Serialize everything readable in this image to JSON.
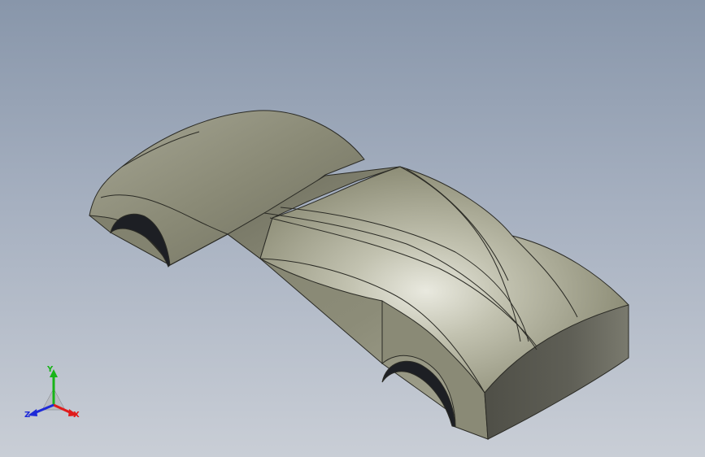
{
  "viewport": {
    "background_top": "#8896aa",
    "background_bottom": "#c9ced6"
  },
  "model": {
    "body_color": "#8f8f7a",
    "edge_color": "#2b2b25"
  },
  "triad": {
    "x_label": "X",
    "y_label": "Y",
    "z_label": "Z",
    "x_color": "#e01b1b",
    "y_color": "#18b418",
    "z_color": "#1e2ad8"
  }
}
